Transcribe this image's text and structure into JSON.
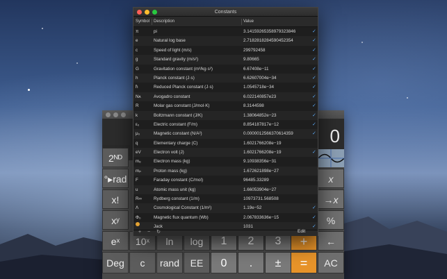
{
  "window": {
    "title": "Constants",
    "columns": {
      "symbol": "Symbol",
      "description": "Description",
      "value": "Value"
    },
    "footer": {
      "add": "+",
      "remove": "−",
      "refresh": "↻",
      "edit": "Edit"
    }
  },
  "constants": [
    {
      "symbol": "π",
      "description": "pi",
      "value": "3.14159265358979323846",
      "checked": true
    },
    {
      "symbol": "e",
      "description": "Natural log base",
      "value": "2.7182818284590452354",
      "checked": true
    },
    {
      "symbol": "c",
      "description": "Speed of light (m/s)",
      "value": "299792458",
      "checked": true
    },
    {
      "symbol": "g",
      "description": "Standard gravity (m/s²)",
      "value": "9.80665",
      "checked": true
    },
    {
      "symbol": "G",
      "description": "Gravitation constant (m³/kg·s²)",
      "value": "6.67408e−11",
      "checked": true
    },
    {
      "symbol": "h",
      "description": "Planck constant (J·s)",
      "value": "6.62607004e−34",
      "checked": true
    },
    {
      "symbol": "ħ",
      "description": "Reduced Planck constant (J·s)",
      "value": "1.0545718e−34",
      "checked": true
    },
    {
      "symbol": "Nᴀ",
      "description": "Avogadro constant",
      "value": "6.022140857e23",
      "checked": true
    },
    {
      "symbol": "R",
      "description": "Molar gas constant (J/mol·K)",
      "value": "8.3144598",
      "checked": true
    },
    {
      "symbol": "k",
      "description": "Boltzmann constant (J/K)",
      "value": "1.38064852e−23",
      "checked": true
    },
    {
      "symbol": "ε₀",
      "description": "Electric constant (F/m)",
      "value": "8.854187817e−12",
      "checked": true
    },
    {
      "symbol": "μ₀",
      "description": "Magnetic constant (N/A²)",
      "value": "0.0000012566370614359",
      "checked": true
    },
    {
      "symbol": "q",
      "description": "Elementary charge (C)",
      "value": "1.6021766208e−19",
      "checked": false
    },
    {
      "symbol": "eV",
      "description": "Electron volt (J)",
      "value": "1.6021766208e−19",
      "checked": true
    },
    {
      "symbol": "mₑ",
      "description": "Electron mass (kg)",
      "value": "9.10938356e−31",
      "checked": false
    },
    {
      "symbol": "mₚ",
      "description": "Proton mass (kg)",
      "value": "1.672621898e−27",
      "checked": false
    },
    {
      "symbol": "F",
      "description": "Faraday constant (C/mol)",
      "value": "96485.33289",
      "checked": false
    },
    {
      "symbol": "u",
      "description": "Atomic mass unit (kg)",
      "value": "1.66053904e−27",
      "checked": false
    },
    {
      "symbol": "R∞",
      "description": "Rydberg constant (1/m)",
      "value": "10973731.568508",
      "checked": false
    },
    {
      "symbol": "Λ",
      "description": "Cosmological Constant (1/m²)",
      "value": "1.19e−52",
      "checked": true
    },
    {
      "symbol": "Φ₀",
      "description": "Magnetic flux quantum (Wb)",
      "value": "2.067833636e−15",
      "checked": true
    },
    {
      "symbol": "",
      "description": "Jack",
      "value": "1031",
      "checked": true,
      "icon": "jack-dot-icon"
    }
  ],
  "calculator": {
    "display": "0",
    "mode": "Radians",
    "keys": [
      {
        "label": "2ᴺᴰ",
        "name": "second-function-key"
      },
      {
        "label": "°▸rad",
        "name": "deg-to-rad-key"
      },
      {
        "label": "x!",
        "name": "factorial-key"
      },
      {
        "label": "xʸ",
        "name": "power-key"
      },
      {
        "label": "eˣ",
        "name": "exp-key"
      },
      {
        "label": "10ˣ",
        "name": "ten-power-key"
      },
      {
        "label": "ln",
        "name": "ln-key"
      },
      {
        "label": "log",
        "name": "log-key"
      },
      {
        "label": "1",
        "name": "digit-1-key"
      },
      {
        "label": "2",
        "name": "digit-2-key"
      },
      {
        "label": "3",
        "name": "digit-3-key"
      },
      {
        "label": "+",
        "name": "plus-key"
      },
      {
        "label": "←",
        "name": "backspace-key"
      },
      {
        "label": "Deg",
        "name": "deg-key"
      },
      {
        "label": "c",
        "name": "c-constant-key"
      },
      {
        "label": "rand",
        "name": "rand-key"
      },
      {
        "label": "EE",
        "name": "ee-key"
      },
      {
        "label": "0",
        "name": "digit-0-key"
      },
      {
        "label": ".",
        "name": "decimal-key"
      },
      {
        "label": "±",
        "name": "sign-key"
      },
      {
        "label": "=",
        "name": "equals-key"
      },
      {
        "label": "AC",
        "name": "all-clear-key"
      },
      {
        "label": "x",
        "name": "x-key"
      },
      {
        "label": "→x",
        "name": "store-x-key"
      },
      {
        "label": "%",
        "name": "percent-key"
      }
    ]
  },
  "colors": {
    "accent": "#e8942a",
    "check": "#5aa7f5",
    "close": "#fc5f57",
    "minimize": "#fdbc2e",
    "zoom": "#28c840"
  }
}
